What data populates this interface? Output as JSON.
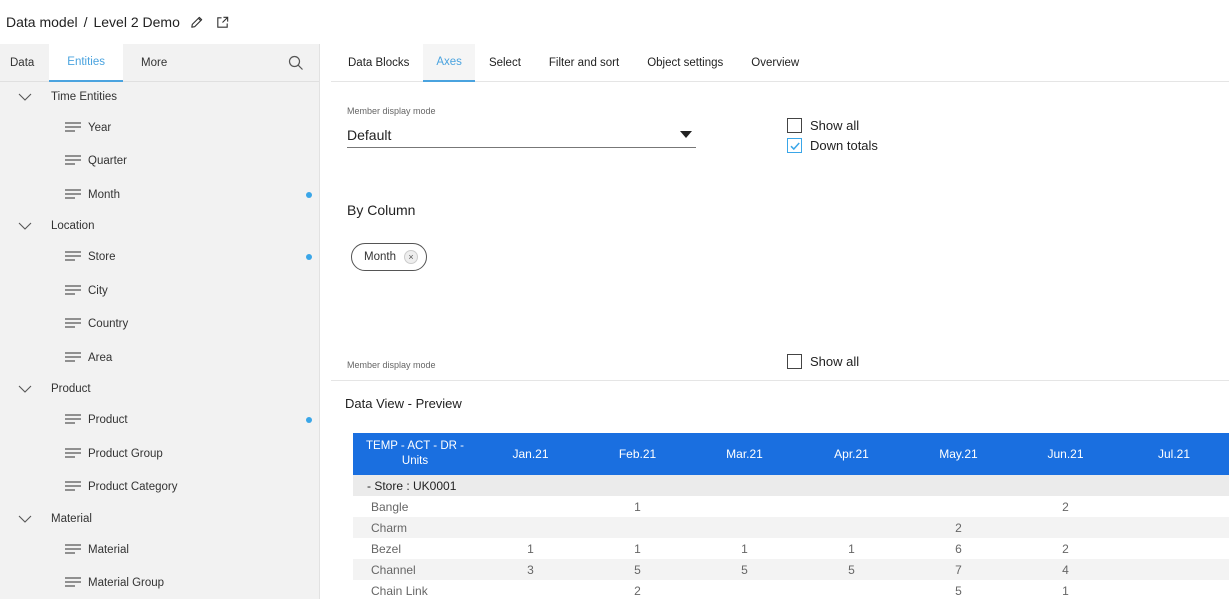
{
  "header": {
    "breadcrumb_root": "Data model",
    "separator": "/",
    "breadcrumb_current": "Level 2 Demo",
    "edit_icon": "pencil-icon",
    "open_icon": "external-link-icon"
  },
  "left_panel": {
    "tabs": [
      "Data",
      "Entities",
      "More"
    ],
    "active_tab": "Entities",
    "search_icon": "search-icon",
    "groups": [
      {
        "label": "Time Entities",
        "items": [
          {
            "label": "Year",
            "dot": false
          },
          {
            "label": "Quarter",
            "dot": false
          },
          {
            "label": "Month",
            "dot": true
          }
        ]
      },
      {
        "label": "Location",
        "items": [
          {
            "label": "Store",
            "dot": true
          },
          {
            "label": "City",
            "dot": false
          },
          {
            "label": "Country",
            "dot": false
          },
          {
            "label": "Area",
            "dot": false
          }
        ]
      },
      {
        "label": "Product",
        "items": [
          {
            "label": "Product",
            "dot": true
          },
          {
            "label": "Product Group",
            "dot": false
          },
          {
            "label": "Product Category",
            "dot": false
          }
        ]
      },
      {
        "label": "Material",
        "items": [
          {
            "label": "Material",
            "dot": false
          },
          {
            "label": "Material Group",
            "dot": false
          }
        ]
      }
    ]
  },
  "right_panel": {
    "tabs": [
      "Data Blocks",
      "Axes",
      "Select",
      "Filter and sort",
      "Object settings",
      "Overview"
    ],
    "active_tab": "Axes",
    "member_display_mode_label": "Member display mode",
    "member_display_mode_value": "Default",
    "show_all_label": "Show all",
    "show_all_checked": false,
    "down_totals_label": "Down totals",
    "down_totals_checked": true,
    "by_column_label": "By Column",
    "column_chip": "Month",
    "chip_remove": "×",
    "member_display_mode_label_2": "Member display mode",
    "show_all_label_2": "Show all",
    "show_all_2_checked": false
  },
  "preview": {
    "title": "Data View - Preview",
    "corner_header": "TEMP - ACT - DR - Units",
    "columns": [
      "Jan.21",
      "Feb.21",
      "Mar.21",
      "Apr.21",
      "May.21",
      "Jun.21",
      "Jul.21"
    ],
    "store_row": "-  Store : UK0001",
    "rows": [
      {
        "label": "Bangle",
        "values": [
          "",
          "1",
          "",
          "",
          "",
          "2",
          ""
        ]
      },
      {
        "label": "Charm",
        "values": [
          "",
          "",
          "",
          "",
          "2",
          "",
          ""
        ]
      },
      {
        "label": "Bezel",
        "values": [
          "1",
          "1",
          "1",
          "1",
          "6",
          "2",
          ""
        ]
      },
      {
        "label": "Channel",
        "values": [
          "3",
          "5",
          "5",
          "5",
          "7",
          "4",
          ""
        ]
      },
      {
        "label": "Chain Link",
        "values": [
          "",
          "2",
          "",
          "",
          "5",
          "1",
          ""
        ]
      }
    ]
  },
  "colors": {
    "accent": "#4aa3df",
    "header_blue": "#1a6fe0",
    "dot": "#3aa6e8"
  }
}
